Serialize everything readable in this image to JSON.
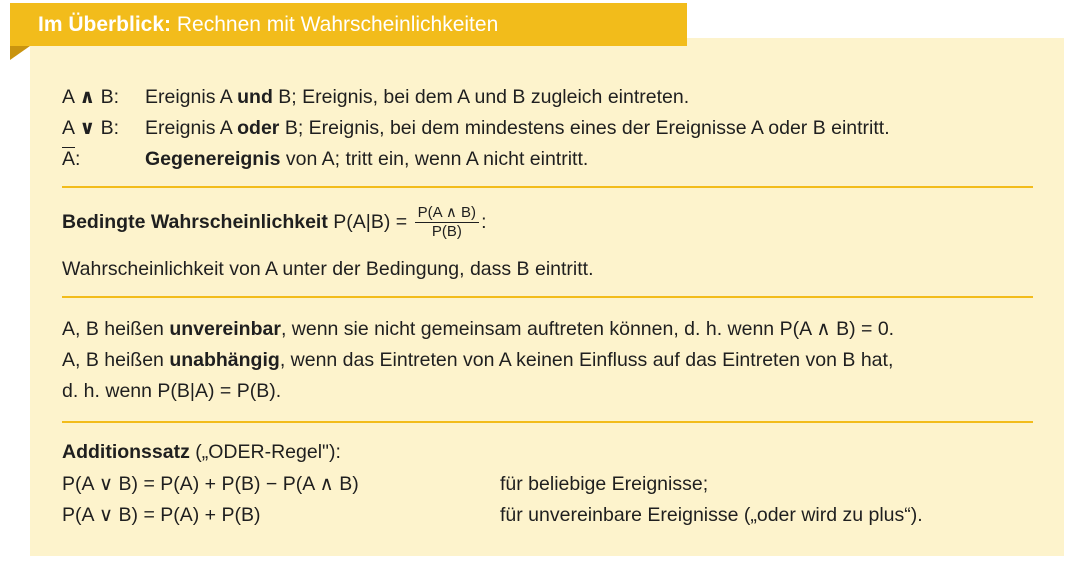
{
  "header": {
    "title_bold": "Im Überblick:",
    "title_rest": " Rechnen mit Wahrscheinlichkeiten"
  },
  "definitions": [
    {
      "symbol_a": "A ",
      "op": "∧",
      "symbol_b": " B:",
      "pre": "Ereignis A ",
      "bold": "und",
      "post": " B; Ereignis, bei dem A und B zugleich eintreten."
    },
    {
      "symbol_a": "A ",
      "op": "∨",
      "symbol_b": " B:",
      "pre": "Ereignis A ",
      "bold": "oder",
      "post": " B; Ereignis, bei dem mindestens eines der Ereignisse A oder B eintritt."
    },
    {
      "symbol_a": "A",
      "symbol_b": ":",
      "pre": "",
      "bold": "Gegenereignis",
      "post": " von A; tritt ein, wenn A nicht eintritt."
    }
  ],
  "conditional": {
    "bold": "Bedingte Wahrscheinlichkeit",
    "lhs": " P(A|B) = ",
    "num": "P(A ∧ B)",
    "den": "P(B)",
    "tail": ":",
    "desc": "Wahrscheinlichkeit von A unter der Bedingung, dass B eintritt."
  },
  "relations": {
    "l1_pre": "A, B heißen ",
    "l1_bold": "unvereinbar",
    "l1_post": ", wenn sie nicht gemeinsam auftreten können, d. h. wenn  P(A ∧ B) = 0.",
    "l2_pre": "A, B heißen ",
    "l2_bold": "unabhängig",
    "l2_post": ", wenn das Eintreten von A keinen Einfluss auf das Eintreten von B hat,",
    "l3": "d. h. wenn  P(B|A) = P(B)."
  },
  "addition": {
    "bold": "Additionssatz",
    "rest": " („ODER-Regel\"):",
    "f1": "P(A ∨ B) = P(A) + P(B) − P(A ∧ B)",
    "f1_note": "für beliebige Ereignisse;",
    "f2": "P(A ∨ B) = P(A) + P(B)",
    "f2_note": "für unvereinbare Ereignisse („oder wird zu plus“)."
  },
  "colors": {
    "accent": "#f2bc1b",
    "box": "#fdf3cc"
  }
}
